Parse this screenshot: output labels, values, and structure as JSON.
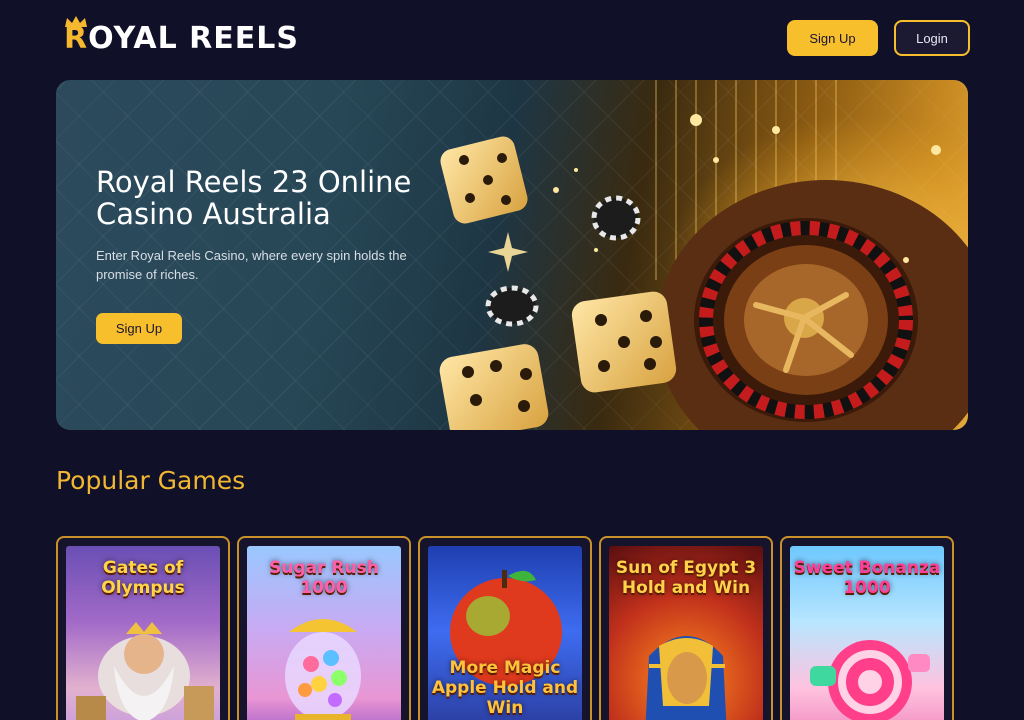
{
  "header": {
    "logo_first_letter": "R",
    "logo_rest": "OYAL REELS",
    "signup_label": "Sign Up",
    "login_label": "Login"
  },
  "hero": {
    "title": "Royal Reels 23 Online Casino Australia",
    "description": "Enter Royal Reels Casino, where every spin holds the promise of riches.",
    "cta_label": "Sign Up"
  },
  "popular": {
    "title": "Popular Games",
    "games": [
      {
        "name": "Gates of Olympus"
      },
      {
        "name": "Sugar Rush 1000"
      },
      {
        "name": "More Magic Apple Hold and Win"
      },
      {
        "name": "Sun of Egypt 3 Hold and Win"
      },
      {
        "name": "Sweet Bonanza 1000"
      }
    ]
  },
  "colors": {
    "background": "#111029",
    "accent": "#f8bf2c",
    "section_title": "#f1b732",
    "card_border": "#c9912a"
  }
}
